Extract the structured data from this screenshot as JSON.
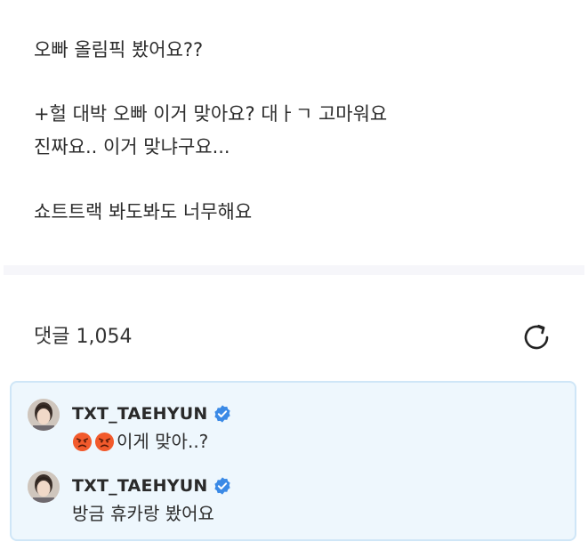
{
  "post": {
    "lines": [
      "오빠 올림픽 봤어요??",
      "+헐 대박 오빠 이거 맞아요? 대ㅏㄱ 고마워요",
      "진짜요.. 이거 맞냐구요...",
      "쇼트트랙 봐도봐도 너무해요"
    ]
  },
  "comments_section": {
    "title": "댓글 1,054",
    "refresh_icon": "refresh-icon"
  },
  "comments": [
    {
      "author": "TXT_TAEHYUN",
      "verified": true,
      "emojis": [
        "angry-face-emoji",
        "angry-face-emoji"
      ],
      "text": "이게 맞아..?"
    },
    {
      "author": "TXT_TAEHYUN",
      "verified": true,
      "text": "방금 휴카랑 봤어요"
    }
  ],
  "colors": {
    "comment_box_bg": "#eef7fd",
    "comment_box_border": "#cfe6f7",
    "verified_badge": "#3b8ae6",
    "divider": "#f6f6fa",
    "angry_emoji": "#f25a2c"
  }
}
